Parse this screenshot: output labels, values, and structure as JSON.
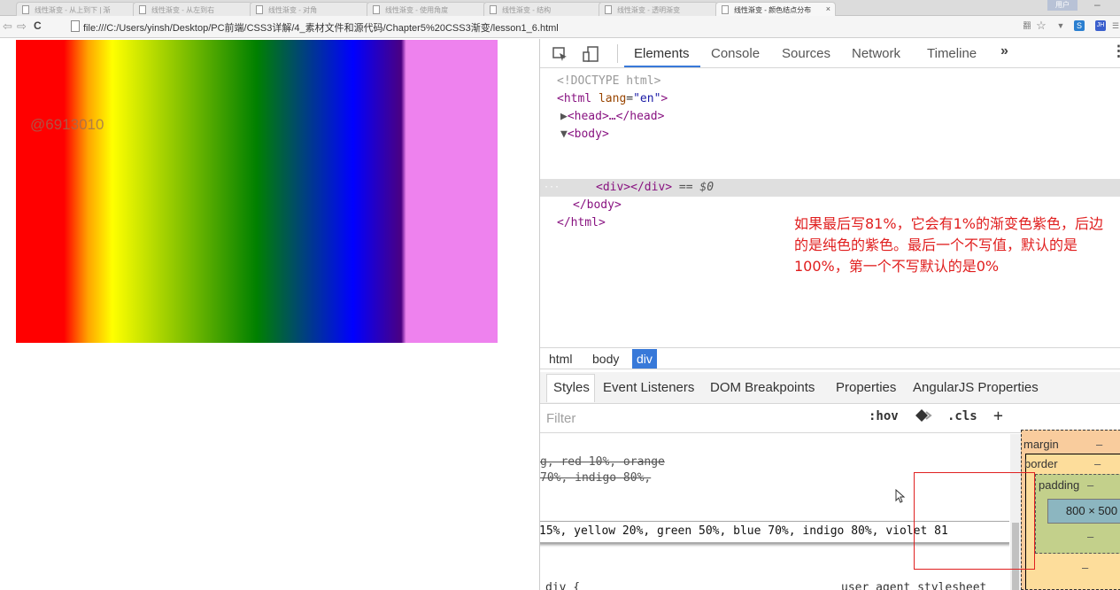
{
  "browser": {
    "tabs": [
      {
        "title": "线性渐变 - 从上到下 | 渐"
      },
      {
        "title": "线性渐变 - 从左到右"
      },
      {
        "title": "线性渐变 - 对角"
      },
      {
        "title": "线性渐变 - 使用角度"
      },
      {
        "title": "线性渐变 - 结构"
      },
      {
        "title": "线性渐变 - 透明渐变"
      },
      {
        "title": "线性渐变 - 颜色结点分布"
      },
      {
        "title": "线性渐变 - 颜色结点分布"
      }
    ],
    "active_tab_close": "×",
    "user_button": "用户",
    "minimize": "–",
    "nav": {
      "back": "⇦",
      "forward": "⇨",
      "reload": "C"
    },
    "url": "file:///C:/Users/yinsh/Desktop/PC前端/CSS3详解/4_素材文件和源代码/Chapter5%20CSS3渐变/lesson1_6.html",
    "extension_icons": [
      {
        "name": "translate-icon",
        "glyph": "翻",
        "color": "#7b7b7b"
      },
      {
        "name": "star-icon",
        "glyph": "☆",
        "color": "#7b7b7b"
      },
      {
        "name": "filter-icon",
        "glyph": "▼",
        "color": "#7b7b7b"
      },
      {
        "name": "screen-icon",
        "glyph": "S",
        "color": "#2b7fd0"
      },
      {
        "name": "jh-icon",
        "glyph": "JH",
        "color": "#3a5fcd"
      },
      {
        "name": "more-icon",
        "glyph": "☰",
        "color": "#7b7b7b"
      }
    ]
  },
  "page": {
    "watermark": "@6913010",
    "gradient_stops": [
      "red 10%",
      "orange 15%",
      "yellow 20%",
      "green 50%",
      "blue 70%",
      "indigo 80%",
      "violet 81%"
    ]
  },
  "devtools": {
    "tabs": [
      "Elements",
      "Console",
      "Sources",
      "Network",
      "Timeline"
    ],
    "more_tabs": "»",
    "kebab": "⋮",
    "dom": {
      "doctype": "<!DOCTYPE html>",
      "html_open": {
        "tag": "html",
        "attr": "lang",
        "value": "\"en\""
      },
      "head": "<head>…</head>",
      "body_open": "<body>",
      "div_line": "<div></div>",
      "div_suffix": "== $0",
      "body_close": "</body>",
      "html_close": "</html>",
      "ellipsis": "···"
    },
    "annotation": "如果最后写81%，它会有1%的渐变色紫色，后边的是纯色的紫色。最后一个不写值，默认的是100%，第一个不写默认的是0%",
    "breadcrumbs": [
      "html",
      "body",
      "div"
    ],
    "subtabs": [
      "Styles",
      "Event Listeners",
      "DOM Breakpoints",
      "Properties",
      "AngularJS Properties"
    ],
    "filter_placeholder": "Filter",
    "filter_buttons": {
      "hov": ":hov",
      "cls": ".cls",
      "add": "+"
    },
    "styles": {
      "strike1": "g, red 10%, orange",
      "strike2": "70%, indigo 80%,",
      "edit_line": "15%, yellow 20%, green 50%, blue 70%, indigo 80%, violet 81",
      "rule_selector": "div {",
      "rule_source": "user agent stylesheet"
    },
    "box_model": {
      "margin_label": "margin",
      "border_label": "border",
      "padding_label": "padding",
      "dash": "–",
      "content_size": "800 × 500"
    }
  }
}
